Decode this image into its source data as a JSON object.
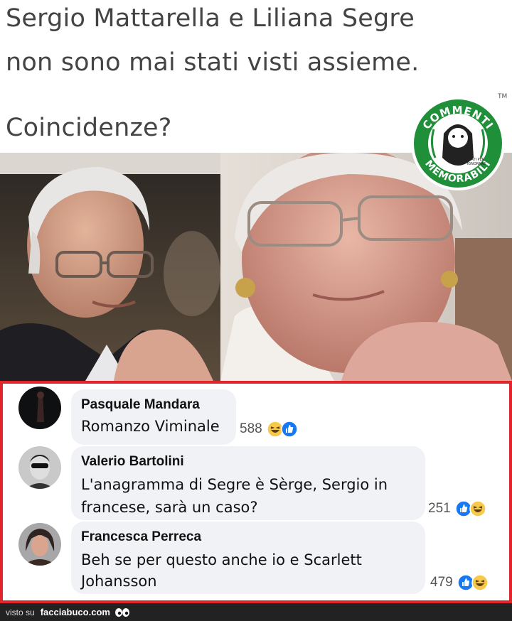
{
  "meme": {
    "line1": "Sergio Mattarella e Liliana Segre",
    "line2": "non sono mai stati visti assieme.",
    "line3": "Coincidenze?"
  },
  "logo": {
    "top_text": "COMMENTI",
    "bottom_text": "MEMORABILI",
    "badge_text_1": "NATI PER",
    "badge_text_2": "IGNORARE",
    "trademark": "TM",
    "green": "#1f8f3a"
  },
  "comments": [
    {
      "author": "Pasquale Mandara",
      "lines": [
        "Romanzo Viminale"
      ],
      "count": "588",
      "reactions": [
        "haha-icon",
        "like-icon"
      ]
    },
    {
      "author": "Valerio Bartolini",
      "lines": [
        "L'anagramma di Segre è Sèrge, Sergio in",
        "francese, sarà un caso?"
      ],
      "count": "251",
      "reactions": [
        "like-icon",
        "haha-icon"
      ]
    },
    {
      "author": "Francesca Perreca",
      "lines": [
        "Beh se per questo anche io e Scarlett",
        "Johansson"
      ],
      "count": "479",
      "reactions": [
        "like-icon",
        "haha-icon"
      ]
    }
  ],
  "footer": {
    "visto_su": "visto su",
    "brand": "facciabuco.com"
  },
  "colors": {
    "frame_red": "#e0262c",
    "like_blue": "#1877f2",
    "haha_yellow": "#f7c94a",
    "bubble_gray": "#f0f2f5"
  }
}
